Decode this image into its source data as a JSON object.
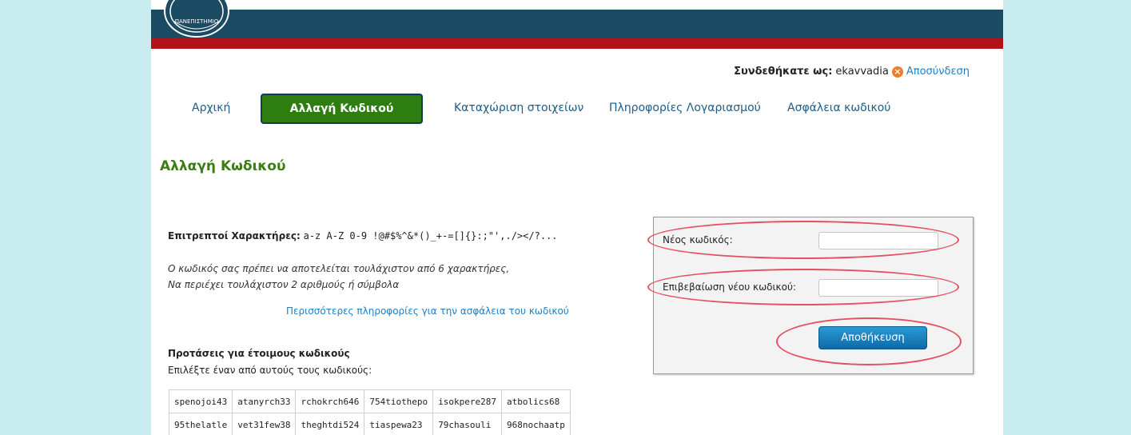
{
  "header": {
    "colors": {
      "top_bar": "#1b4a63",
      "accent_bar": "#b1121a",
      "background": "#c9ecf1"
    }
  },
  "user_bar": {
    "logged_in_label": "Συνδεθήκατε ως:",
    "username": "ekavvadia",
    "logout_icon": "close-circle-icon",
    "logout_label": "Αποσύνδεση"
  },
  "nav": {
    "items": [
      {
        "label": "Αρχική",
        "active": false
      },
      {
        "label": "Αλλαγή Κωδικού",
        "active": true
      },
      {
        "label": "Καταχώριση στοιχείων",
        "active": false
      },
      {
        "label": "Πληροφορίες Λογαριασμού",
        "active": false
      },
      {
        "label": "Ασφάλεια κωδικού",
        "active": false
      }
    ],
    "active_color": "#2d7d10"
  },
  "main": {
    "title": "Αλλαγή Κωδικού",
    "allowed_label": "Επιτρεπτοί Χαρακτήρες:",
    "allowed_chars": "a-z A-Z 0-9 !@#$%^&*()_+-=[]{}:;\"',./></?...",
    "rules": [
      "Ο κωδικός σας πρέπει να αποτελείται τουλάχιστον από 6 χαρακτήρες,",
      "Να περιέχει τουλάχιστον 2 αριθμούς ή σύμβολα"
    ],
    "more_info_link": "Περισσότερες πληροφορίες για την ασφάλεια του κωδικού",
    "suggestions_title": "Προτάσεις για έτοιμους κωδικούς",
    "suggestions_subtitle": "Επιλέξτε έναν από αυτούς τους κωδικούς:",
    "suggestions": [
      [
        "spenojoi43",
        "atanyrch33",
        "rchokrch646",
        "754tiothepo",
        "isokpere287",
        "atbolics68"
      ],
      [
        "95thelatle",
        "vet31few38",
        "theghtdi524",
        "tiaspewa23",
        "79chasouli",
        "968nochaatp"
      ]
    ]
  },
  "form": {
    "new_password_label": "Νέος κωδικός:",
    "new_password_value": "",
    "confirm_label": "Επιβεβαίωση νέου κωδικού:",
    "confirm_value": "",
    "save_label": "Αποθήκευση",
    "highlight_color": "#e64e62"
  }
}
